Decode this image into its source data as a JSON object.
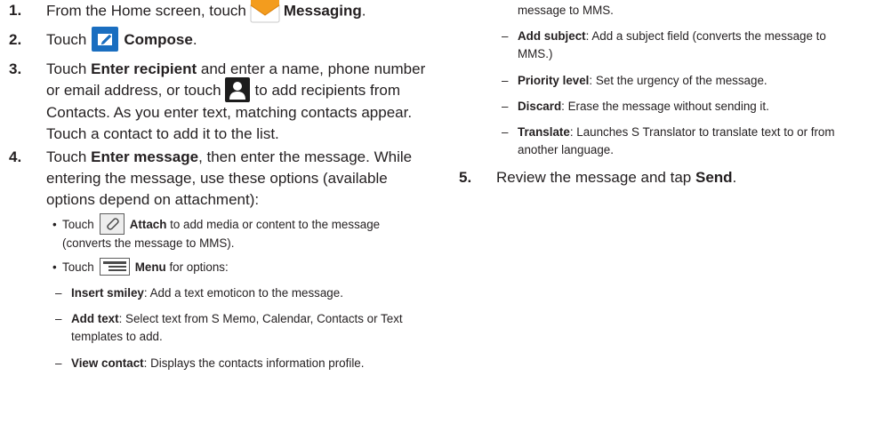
{
  "steps": [
    {
      "num": "1.",
      "l1_pre": "From the Home screen, touch",
      "l1_bold": "Messaging",
      "l1_post": "."
    },
    {
      "num": "2.",
      "l1_pre": "Touch",
      "l1_bold": "Compose",
      "l1_post": "."
    },
    {
      "num": "3.",
      "l1_pre": "Touch",
      "l1_bold": "Enter recipient",
      "l1_post": "and enter a name, phone number",
      "l2_pre": "or email address, or touch",
      "l2_post": "to add recipients from",
      "l3": "Contacts. As you enter text, matching contacts appear.",
      "l4": "Touch a contact to add it to the list."
    },
    {
      "num": "4.",
      "l1_pre": "Touch",
      "l1_bold": "Enter message",
      "l1_post": ", then enter the message. While",
      "l2": "entering the message, use these options (available",
      "l3": "options depend on attachment):"
    },
    {
      "num": "5.",
      "l1_pre": "Review the message and tap",
      "l1_bold": "Send",
      "l1_post": "."
    }
  ],
  "attach": {
    "pre": "Touch",
    "bold": "Attach",
    "post": "to add media or content to the message",
    "l2": "(converts the message to MMS)."
  },
  "menu": {
    "pre": "Touch",
    "bold": "Menu",
    "post": "for options:"
  },
  "options": {
    "smiley": {
      "name": "Insert smiley",
      "desc": ": Add a text emoticon to the message."
    },
    "add_text": {
      "name": "Add text",
      "desc": ": Select text from S Memo, Calendar, Contacts or Text",
      "l2": "templates to add."
    },
    "view_contact": {
      "name": "View contact",
      "desc": ": Displays the contacts information profile."
    },
    "continued": "message to MMS.",
    "add_subject": {
      "name": "Add subject",
      "desc": ": Add a subject field (converts the message to",
      "l2": "MMS.)"
    },
    "priority": {
      "name": "Priority level",
      "desc": ": Set the urgency of the message."
    },
    "discard": {
      "name": "Discard",
      "desc": ": Erase the message without sending it."
    },
    "translate": {
      "name": "Translate",
      "desc": ": Launches S Translator to translate text to or from",
      "l2": "another language."
    }
  },
  "glyphs": {
    "bullet": "•",
    "dash": "–"
  },
  "icons": [
    "messaging-icon",
    "compose-icon",
    "contacts-icon",
    "attach-icon",
    "menu-icon"
  ],
  "colors": {
    "compose_blue": "#1a6ec0",
    "messaging_orange": "#f39c1e",
    "text": "#231f20"
  }
}
